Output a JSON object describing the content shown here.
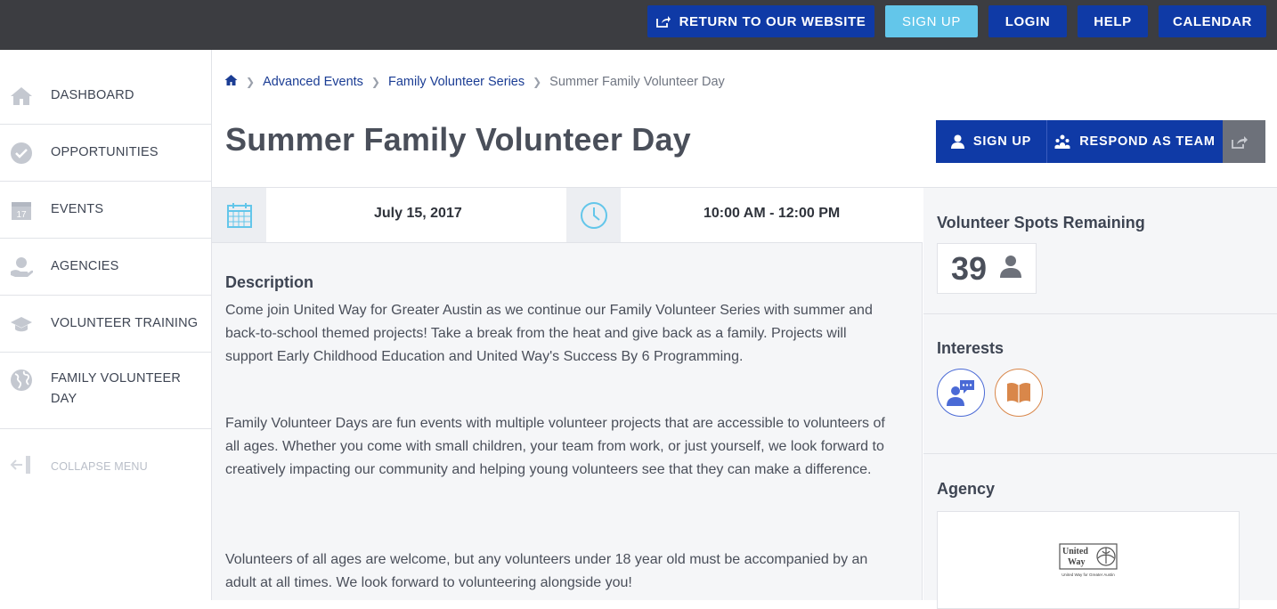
{
  "topnav": {
    "return": "RETURN TO OUR WEBSITE",
    "signup": "SIGN UP",
    "login": "LOGIN",
    "help": "HELP",
    "calendar": "CALENDAR"
  },
  "sidebar": {
    "items": [
      {
        "label": "DASHBOARD",
        "icon": "home-icon"
      },
      {
        "label": "OPPORTUNITIES",
        "icon": "check-circle-icon"
      },
      {
        "label": "EVENTS",
        "icon": "calendar-17-icon"
      },
      {
        "label": "AGENCIES",
        "icon": "hand-heart-icon"
      },
      {
        "label": "VOLUNTEER TRAINING",
        "icon": "graduation-cap-icon"
      },
      {
        "label": "FAMILY VOLUNTEER DAY",
        "icon": "globe-icon"
      }
    ],
    "collapse": "COLLAPSE MENU"
  },
  "breadcrumb": {
    "items": [
      "Advanced Events",
      "Family Volunteer Series"
    ],
    "current": "Summer Family Volunteer Day"
  },
  "page": {
    "title": "Summer Family Volunteer Day",
    "signup": "SIGN UP",
    "respond_team": "RESPOND AS TEAM"
  },
  "event": {
    "date": "July 15, 2017",
    "time": "10:00 AM - 12:00 PM"
  },
  "description": {
    "heading": "Description",
    "p1": "Come join United Way for Greater Austin as we continue our Family Volunteer Series with summer and back-to-school themed projects!  Take a break from the heat and give back as a family.  Projects will support Early Childhood Education and United Way's Success By 6 Programming.",
    "p2": "Family Volunteer Days are fun events with multiple volunteer projects that are accessible to volunteers of all ages.  Whether you come with small children, your team from work, or just yourself, we look forward to creatively impacting our community and helping young volunteers see that they can make a difference.",
    "p3": "Volunteers of all ages are welcome, but any volunteers under 18 year old must be accompanied by an adult at all times.  We look forward to volunteering alongside you!"
  },
  "sidepanel": {
    "spots_heading": "Volunteer Spots Remaining",
    "spots": "39",
    "interests_heading": "Interests",
    "agency_heading": "Agency",
    "agency_logo_text": "United Way",
    "agency_logo_sub": "United Way for Greater Austin"
  },
  "colors": {
    "nav_blue": "#0f3aa6",
    "signup_light": "#63c6ea",
    "topbar": "#3c3d41",
    "interest_blue": "#4a6ad6",
    "interest_orange": "#d9874a"
  }
}
